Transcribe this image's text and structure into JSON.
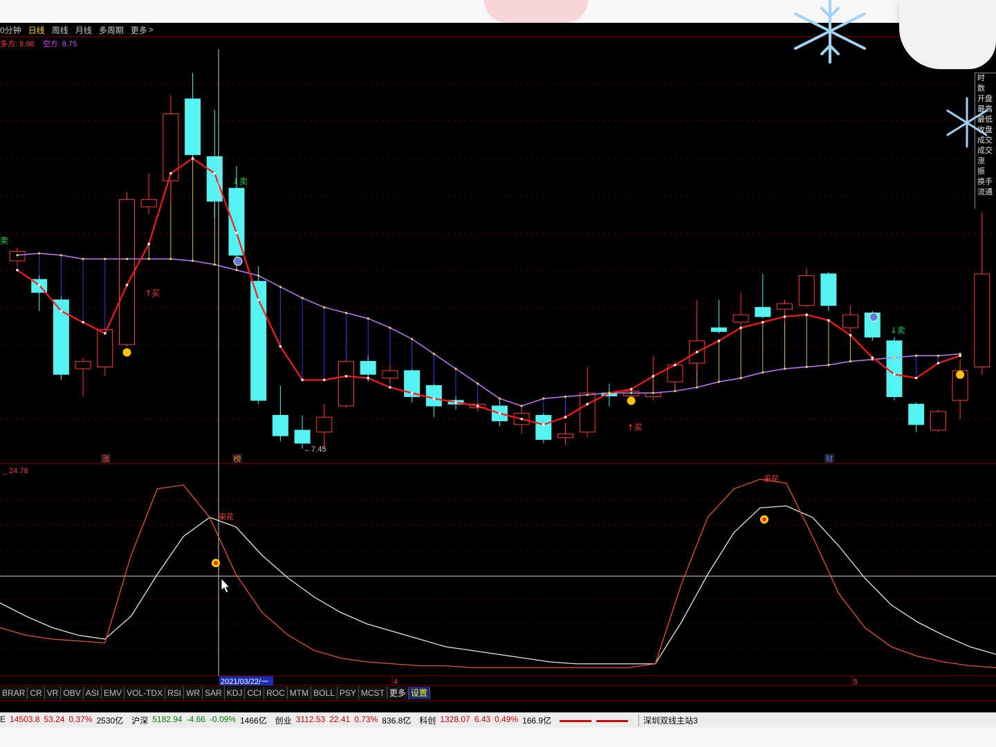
{
  "toolbar": {
    "periods": [
      "0分钟",
      "日线",
      "周线",
      "月线",
      "多周期",
      "更多"
    ],
    "active_period": "日线",
    "more_arrow": ">"
  },
  "strength": {
    "bull_label": "多方:",
    "bull_value": "8.98",
    "bear_label": "空方:",
    "bear_value": "8.75"
  },
  "main_chart": {
    "candles": [
      {
        "o": 12.25,
        "c": 12.5,
        "h": 12.6,
        "l": 12.1
      },
      {
        "o": 11.75,
        "c": 11.4,
        "h": 11.85,
        "l": 10.9
      },
      {
        "o": 11.2,
        "c": 9.2,
        "h": 11.3,
        "l": 9.05
      },
      {
        "o": 9.35,
        "c": 9.55,
        "h": 9.65,
        "l": 8.6
      },
      {
        "o": 9.4,
        "c": 10.4,
        "h": 10.45,
        "l": 9.15
      },
      {
        "o": 10.0,
        "c": 13.9,
        "h": 14.1,
        "l": 9.95
      },
      {
        "o": 13.7,
        "c": 13.9,
        "h": 14.6,
        "l": 13.5
      },
      {
        "o": 14.4,
        "c": 16.2,
        "h": 16.7,
        "l": 13.8
      },
      {
        "o": 16.6,
        "c": 15.1,
        "h": 17.3,
        "l": 14.9
      },
      {
        "o": 15.05,
        "c": 13.85,
        "h": 16.3,
        "l": 13.4
      },
      {
        "o": 14.2,
        "c": 12.4,
        "h": 14.8,
        "l": 12.3
      },
      {
        "o": 11.7,
        "c": 8.5,
        "h": 12.1,
        "l": 8.4
      },
      {
        "o": 8.1,
        "c": 7.55,
        "h": 8.9,
        "l": 7.4
      },
      {
        "o": 7.7,
        "c": 7.35,
        "h": 8.1,
        "l": 7.2
      },
      {
        "o": 7.65,
        "c": 8.05,
        "h": 8.4,
        "l": 7.2
      },
      {
        "o": 8.35,
        "c": 9.55,
        "h": 9.6,
        "l": 8.3
      },
      {
        "o": 9.55,
        "c": 9.2,
        "h": 9.7,
        "l": 9.0
      },
      {
        "o": 9.1,
        "c": 9.3,
        "h": 9.45,
        "l": 8.95
      },
      {
        "o": 9.3,
        "c": 8.6,
        "h": 9.35,
        "l": 8.45
      },
      {
        "o": 8.9,
        "c": 8.35,
        "h": 8.95,
        "l": 8.05
      },
      {
        "o": 8.5,
        "c": 8.4,
        "h": 8.6,
        "l": 8.25
      },
      {
        "o": 8.3,
        "c": 8.4,
        "h": 8.45,
        "l": 8.2
      },
      {
        "o": 8.35,
        "c": 7.95,
        "h": 8.5,
        "l": 7.8
      },
      {
        "o": 7.85,
        "c": 8.15,
        "h": 8.3,
        "l": 7.6
      },
      {
        "o": 8.1,
        "c": 7.45,
        "h": 8.15,
        "l": 7.35
      },
      {
        "o": 7.5,
        "c": 7.6,
        "h": 7.9,
        "l": 7.3
      },
      {
        "o": 7.65,
        "c": 8.7,
        "h": 9.4,
        "l": 7.5
      },
      {
        "o": 8.7,
        "c": 8.62,
        "h": 8.95,
        "l": 8.35
      },
      {
        "o": 8.62,
        "c": 8.75,
        "h": 8.85,
        "l": 8.5
      },
      {
        "o": 8.6,
        "c": 8.7,
        "h": 9.7,
        "l": 8.5
      },
      {
        "o": 9.0,
        "c": 9.45,
        "h": 9.55,
        "l": 8.9
      },
      {
        "o": 9.5,
        "c": 10.1,
        "h": 11.2,
        "l": 9.3
      },
      {
        "o": 10.45,
        "c": 10.35,
        "h": 11.2,
        "l": 10.3
      },
      {
        "o": 10.6,
        "c": 10.8,
        "h": 11.4,
        "l": 10.5
      },
      {
        "o": 11.0,
        "c": 10.75,
        "h": 11.9,
        "l": 10.7
      },
      {
        "o": 10.95,
        "c": 11.1,
        "h": 11.2,
        "l": 10.6
      },
      {
        "o": 11.05,
        "c": 11.85,
        "h": 12.05,
        "l": 11.0
      },
      {
        "o": 11.9,
        "c": 11.05,
        "h": 11.95,
        "l": 10.9
      },
      {
        "o": 10.45,
        "c": 10.8,
        "h": 11.05,
        "l": 10.3
      },
      {
        "o": 10.85,
        "c": 10.2,
        "h": 10.9,
        "l": 10.1
      },
      {
        "o": 10.1,
        "c": 8.6,
        "h": 10.2,
        "l": 8.5
      },
      {
        "o": 8.4,
        "c": 7.85,
        "h": 8.45,
        "l": 7.65
      },
      {
        "o": 7.7,
        "c": 8.2,
        "h": 8.25,
        "l": 7.65
      },
      {
        "o": 8.5,
        "c": 9.3,
        "h": 9.6,
        "l": 8.0
      },
      {
        "o": 9.4,
        "c": 11.9,
        "h": 13.55,
        "l": 9.2
      },
      {
        "o": 11.85,
        "c": 10.85,
        "h": 11.9,
        "l": 10.7
      }
    ],
    "red_line": [
      12.0,
      11.6,
      10.9,
      10.6,
      10.3,
      11.6,
      12.7,
      14.6,
      15.0,
      14.6,
      13.0,
      11.2,
      9.95,
      9.05,
      9.05,
      9.15,
      9.1,
      8.85,
      8.7,
      8.55,
      8.45,
      8.35,
      8.15,
      8.0,
      7.85,
      8.05,
      8.4,
      8.7,
      8.8,
      9.15,
      9.45,
      9.8,
      10.1,
      10.45,
      10.6,
      10.75,
      10.8,
      10.65,
      10.25,
      9.65,
      9.2,
      9.1,
      9.5,
      9.7
    ],
    "purple_line": [
      12.4,
      12.45,
      12.4,
      12.3,
      12.3,
      12.3,
      12.3,
      12.3,
      12.25,
      12.15,
      12.0,
      11.85,
      11.55,
      11.25,
      11.0,
      10.85,
      10.7,
      10.45,
      10.15,
      9.75,
      9.35,
      8.95,
      8.55,
      8.35,
      8.55,
      8.6,
      8.65,
      8.7,
      8.7,
      8.7,
      8.75,
      8.85,
      9.0,
      9.1,
      9.25,
      9.35,
      9.4,
      9.45,
      9.55,
      9.6,
      9.65,
      9.7,
      9.7,
      9.75
    ],
    "signals": [
      {
        "text": "卖",
        "type": "sell",
        "i": 0
      },
      {
        "text": "↑买",
        "type": "buy",
        "i": 6
      },
      {
        "text": "↓卖",
        "type": "sell",
        "i": 10
      },
      {
        "text": "↑买",
        "type": "buy",
        "i": 28
      },
      {
        "text": "↓卖",
        "type": "sell",
        "i": 40
      }
    ],
    "low_marker": "←7.45",
    "event_tags": [
      "涨",
      "榜",
      "财"
    ]
  },
  "sub_chart": {
    "value_label": "24.78",
    "signal_text": "采花",
    "fast_line": [
      22,
      18,
      16,
      15,
      14,
      60,
      95,
      97,
      80,
      50,
      30,
      18,
      10,
      6,
      4,
      3,
      2,
      2,
      1,
      1,
      1,
      1,
      1,
      1,
      1,
      3,
      45,
      80,
      95,
      100,
      98,
      70,
      40,
      22,
      12,
      7,
      4,
      2,
      1
    ],
    "slow_line": [
      35,
      28,
      22,
      18,
      16,
      28,
      50,
      70,
      80,
      75,
      60,
      48,
      38,
      30,
      24,
      20,
      16,
      12,
      10,
      8,
      6,
      4,
      3,
      3,
      3,
      3,
      25,
      50,
      72,
      85,
      86,
      80,
      65,
      48,
      34,
      25,
      18,
      12,
      8
    ],
    "ref_level": 55
  },
  "date_axis": {
    "cursor_date": "2021/03/22/一",
    "month_marks": [
      "4",
      "5"
    ]
  },
  "indicator_tabs": [
    "BRAR",
    "CR",
    "VR",
    "OBV",
    "ASI",
    "EMV",
    "VOL-TDX",
    "RSI",
    "WR",
    "SAR",
    "KDJ",
    "CCI",
    "ROC",
    "MTM",
    "BOLL",
    "PSY",
    "MCST",
    "更多",
    "设置"
  ],
  "info_panel": [
    "时",
    "数",
    "开盘",
    "最高",
    "最低",
    "收盘",
    "成交",
    "成交",
    "涨",
    "振",
    "换手",
    "流通"
  ],
  "status_bar": {
    "indices": [
      {
        "name": "E",
        "value": "14503.8",
        "change": "53.24",
        "pct": "0.37%",
        "amount": "2530亿",
        "dir": "up"
      },
      {
        "name": "沪深",
        "value": "5182.94",
        "change": "-4.66",
        "pct": "-0.09%",
        "amount": "1466亿",
        "dir": "down"
      },
      {
        "name": "创业",
        "value": "3112.53",
        "change": "22.41",
        "pct": "0.73%",
        "amount": "836.8亿",
        "dir": "up"
      },
      {
        "name": "科创",
        "value": "1328.07",
        "change": "6.43",
        "pct": "0.49%",
        "amount": "166.9亿",
        "dir": "up"
      }
    ],
    "server": "深圳双线主站3"
  },
  "colors": {
    "up": "#ff3b3b",
    "down": "#55f2f2",
    "red_line": "#ff1a1a",
    "purple_line": "#c27bff",
    "grid": "#8a0000",
    "sub_fast": "#e2562a",
    "sub_slow": "#e8e8e8",
    "cursor": "#d0d0d0"
  }
}
